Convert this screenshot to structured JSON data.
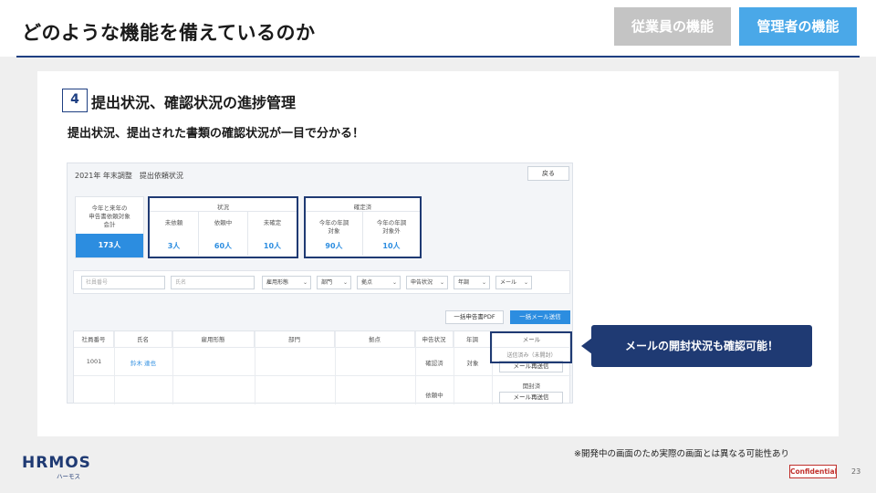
{
  "header": {
    "title": "どのような機能を備えているのか",
    "staff_tab": "従業員の機能",
    "admin_tab": "管理者の機能"
  },
  "section": {
    "number": "4",
    "title": "提出状況、確認状況の進捗管理",
    "subtitle": "提出状況、提出された書類の確認状況が一目で分かる！"
  },
  "app": {
    "page_title": "2021年 年末調整　提出依頼状況",
    "back_button": "戻る",
    "summary": {
      "total_label_1": "今年と来年の",
      "total_label_2": "申告書依頼対象",
      "total_label_3": "会計",
      "total_value": "173人",
      "status_group": "状況",
      "status_cols": [
        {
          "label": "未依頼",
          "value": "3人"
        },
        {
          "label": "依頼中",
          "value": "60人"
        },
        {
          "label": "未確定",
          "value": "10人"
        }
      ],
      "confirm_group": "確定済",
      "confirm_cols": [
        {
          "label_1": "今年の年調",
          "label_2": "対象",
          "value": "90人"
        },
        {
          "label_1": "今年の年調",
          "label_2": "対象外",
          "value": "10人"
        }
      ]
    },
    "filters": {
      "employee_no_placeholder": "社員番号",
      "name_placeholder": "氏名",
      "employment_type": "雇用形態",
      "department": "部門",
      "location": "拠点",
      "form_status": "申告状況",
      "year_adjustment": "年調",
      "mail": "メール"
    },
    "bulk_pdf_button": "一括申告書PDF",
    "bulk_mail_button": "一括メール送信",
    "table": {
      "headers": [
        "社員番号",
        "氏名",
        "雇用形態",
        "部門",
        "拠点",
        "申告状況",
        "年調",
        "メール"
      ],
      "row1": {
        "employee_no": "1001",
        "name": "鈴木 達也",
        "form_status": "確認済",
        "year_adjustment": "対象",
        "mail_status": "送信済み（未開封）",
        "resend": "メール再送信"
      },
      "row2": {
        "form_status": "依頼中",
        "mail_status": "開封済",
        "resend": "メール再送信"
      }
    }
  },
  "callout": "メールの開封状況も確認可能！",
  "footer": {
    "note": "※開発中の画面のため実際の画面とは異なる可能性あり",
    "logo": "HRMOS",
    "logo_sub": "ハーモス",
    "confidential": "Confidential",
    "page": "23"
  }
}
